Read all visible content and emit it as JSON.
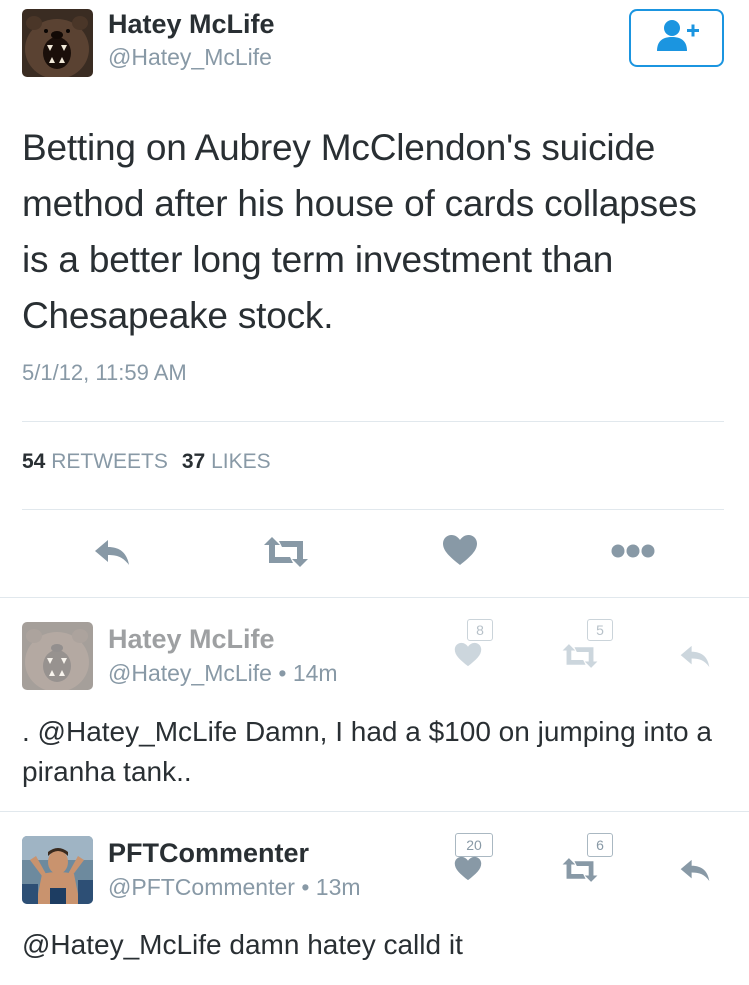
{
  "main_tweet": {
    "author_name": "Hatey McLife",
    "author_handle": "@Hatey_McLife",
    "text": "Betting on Aubrey McClendon's suicide method after his house of cards collapses is a better long term investment than Chesapeake stock.",
    "timestamp": "5/1/12, 11:59 AM",
    "retweets_count": "54",
    "retweets_label": "RETWEETS",
    "likes_count": "37",
    "likes_label": "LIKES",
    "icons": [
      "follow-icon",
      "reply-icon",
      "retweet-icon",
      "like-icon",
      "more-icon"
    ]
  },
  "replies": [
    {
      "author_name": "Hatey McLife",
      "author_handle": "@Hatey_McLife",
      "time": "14m",
      "text": ". @Hatey_McLife Damn, I had a $100 on jumping into a piranha tank..",
      "like_count": "8",
      "retweet_count": "5"
    },
    {
      "author_name": "PFTCommenter",
      "author_handle": "@PFTCommenter",
      "time": "13m",
      "text": "@Hatey_McLife damn hatey calld it",
      "like_count": "20",
      "retweet_count": "6"
    }
  ],
  "separator": "•",
  "colors": {
    "text": "#292f33",
    "secondary": "#8899a6",
    "accent": "#1b95e0",
    "divider": "#e1e8ed",
    "icon": "#8899a6"
  }
}
